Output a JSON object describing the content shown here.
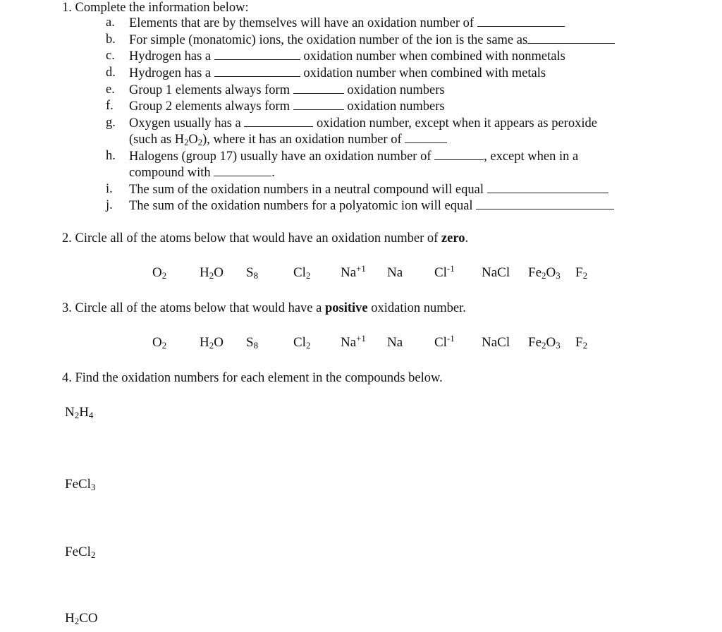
{
  "q1": {
    "title": "1. Complete the information below:",
    "items": [
      {
        "letter": "a.",
        "parts": [
          {
            "t": "Elements that are by themselves will have an oxidation number of "
          },
          {
            "blank": 124
          }
        ]
      },
      {
        "letter": "b.",
        "parts": [
          {
            "t": "For simple (monatomic) ions, the oxidation number of the ion is the same as"
          },
          {
            "blank": 124
          }
        ]
      },
      {
        "letter": "c.",
        "parts": [
          {
            "t": "Hydrogen has a "
          },
          {
            "blank": 122
          },
          {
            "t": " oxidation number when combined with nonmetals"
          }
        ]
      },
      {
        "letter": "d.",
        "parts": [
          {
            "t": "Hydrogen has a "
          },
          {
            "blank": 122
          },
          {
            "t": " oxidation number when combined with metals"
          }
        ]
      },
      {
        "letter": "e.",
        "parts": [
          {
            "t": "Group 1 elements always form "
          },
          {
            "blank": 72
          },
          {
            "t": " oxidation numbers"
          }
        ]
      },
      {
        "letter": "f.",
        "parts": [
          {
            "t": "Group 2 elements always form "
          },
          {
            "blank": 72
          },
          {
            "t": " oxidation numbers"
          }
        ]
      },
      {
        "letter": "g.",
        "parts": [
          {
            "t": "Oxygen usually has a "
          },
          {
            "blank": 98
          },
          {
            "t": " oxidation number, except when it appears as peroxide"
          }
        ]
      },
      {
        "letter": "",
        "parts": [
          {
            "t": "(such as H"
          },
          {
            "sub": "2"
          },
          {
            "t": "O"
          },
          {
            "sub": "2"
          },
          {
            "t": "), where it has an oxidation number of "
          },
          {
            "blank": 60
          }
        ]
      },
      {
        "letter": "h.",
        "parts": [
          {
            "t": "Halogens (group 17) usually have an oxidation number of "
          },
          {
            "blank": 70
          },
          {
            "t": ", except when in a"
          }
        ]
      },
      {
        "letter": "",
        "parts": [
          {
            "t": "compound with "
          },
          {
            "blank": 82
          },
          {
            "t": "."
          }
        ]
      },
      {
        "letter": "i.",
        "parts": [
          {
            "t": "The sum of the oxidation numbers in a neutral compound will equal "
          },
          {
            "blank": 172
          }
        ]
      },
      {
        "letter": "j.",
        "parts": [
          {
            "t": "The sum of the oxidation numbers for a polyatomic ion will equal "
          },
          {
            "blank": 196
          }
        ]
      }
    ]
  },
  "q2": {
    "prefix": "2. Circle all of the atoms below that would have an oxidation number of ",
    "bold": "zero",
    "suffix": "."
  },
  "q3": {
    "prefix": "3. Circle all of the atoms below that would have a ",
    "bold": "positive",
    "suffix": " oxidation number."
  },
  "species": [
    [
      {
        "t": "O"
      },
      {
        "sub": "2"
      }
    ],
    [
      {
        "t": "H"
      },
      {
        "sub": "2"
      },
      {
        "t": "O"
      }
    ],
    [
      {
        "t": "S"
      },
      {
        "sub": "8"
      }
    ],
    [
      {
        "t": "Cl"
      },
      {
        "sub": "2"
      }
    ],
    [
      {
        "t": "Na"
      },
      {
        "sup": "+1"
      }
    ],
    [
      {
        "t": "Na"
      }
    ],
    [
      {
        "t": "Cl"
      },
      {
        "sup": "-1"
      }
    ],
    [
      {
        "t": "NaCl"
      }
    ],
    [
      {
        "t": "Fe"
      },
      {
        "sub": "2"
      },
      {
        "t": "O"
      },
      {
        "sub": "3"
      }
    ],
    [
      {
        "t": "F"
      },
      {
        "sub": "2"
      }
    ]
  ],
  "q4": {
    "title": "4. Find the oxidation numbers for each element in the compounds below.",
    "compounds": [
      [
        {
          "t": "N"
        },
        {
          "sub": "2"
        },
        {
          "t": "H"
        },
        {
          "sub": "4"
        }
      ],
      [
        {
          "t": "FeCl"
        },
        {
          "sub": "3"
        }
      ],
      [
        {
          "t": "FeCl"
        },
        {
          "sub": "2"
        }
      ],
      [
        {
          "t": "H"
        },
        {
          "sub": "2"
        },
        {
          "t": "CO"
        }
      ]
    ]
  }
}
